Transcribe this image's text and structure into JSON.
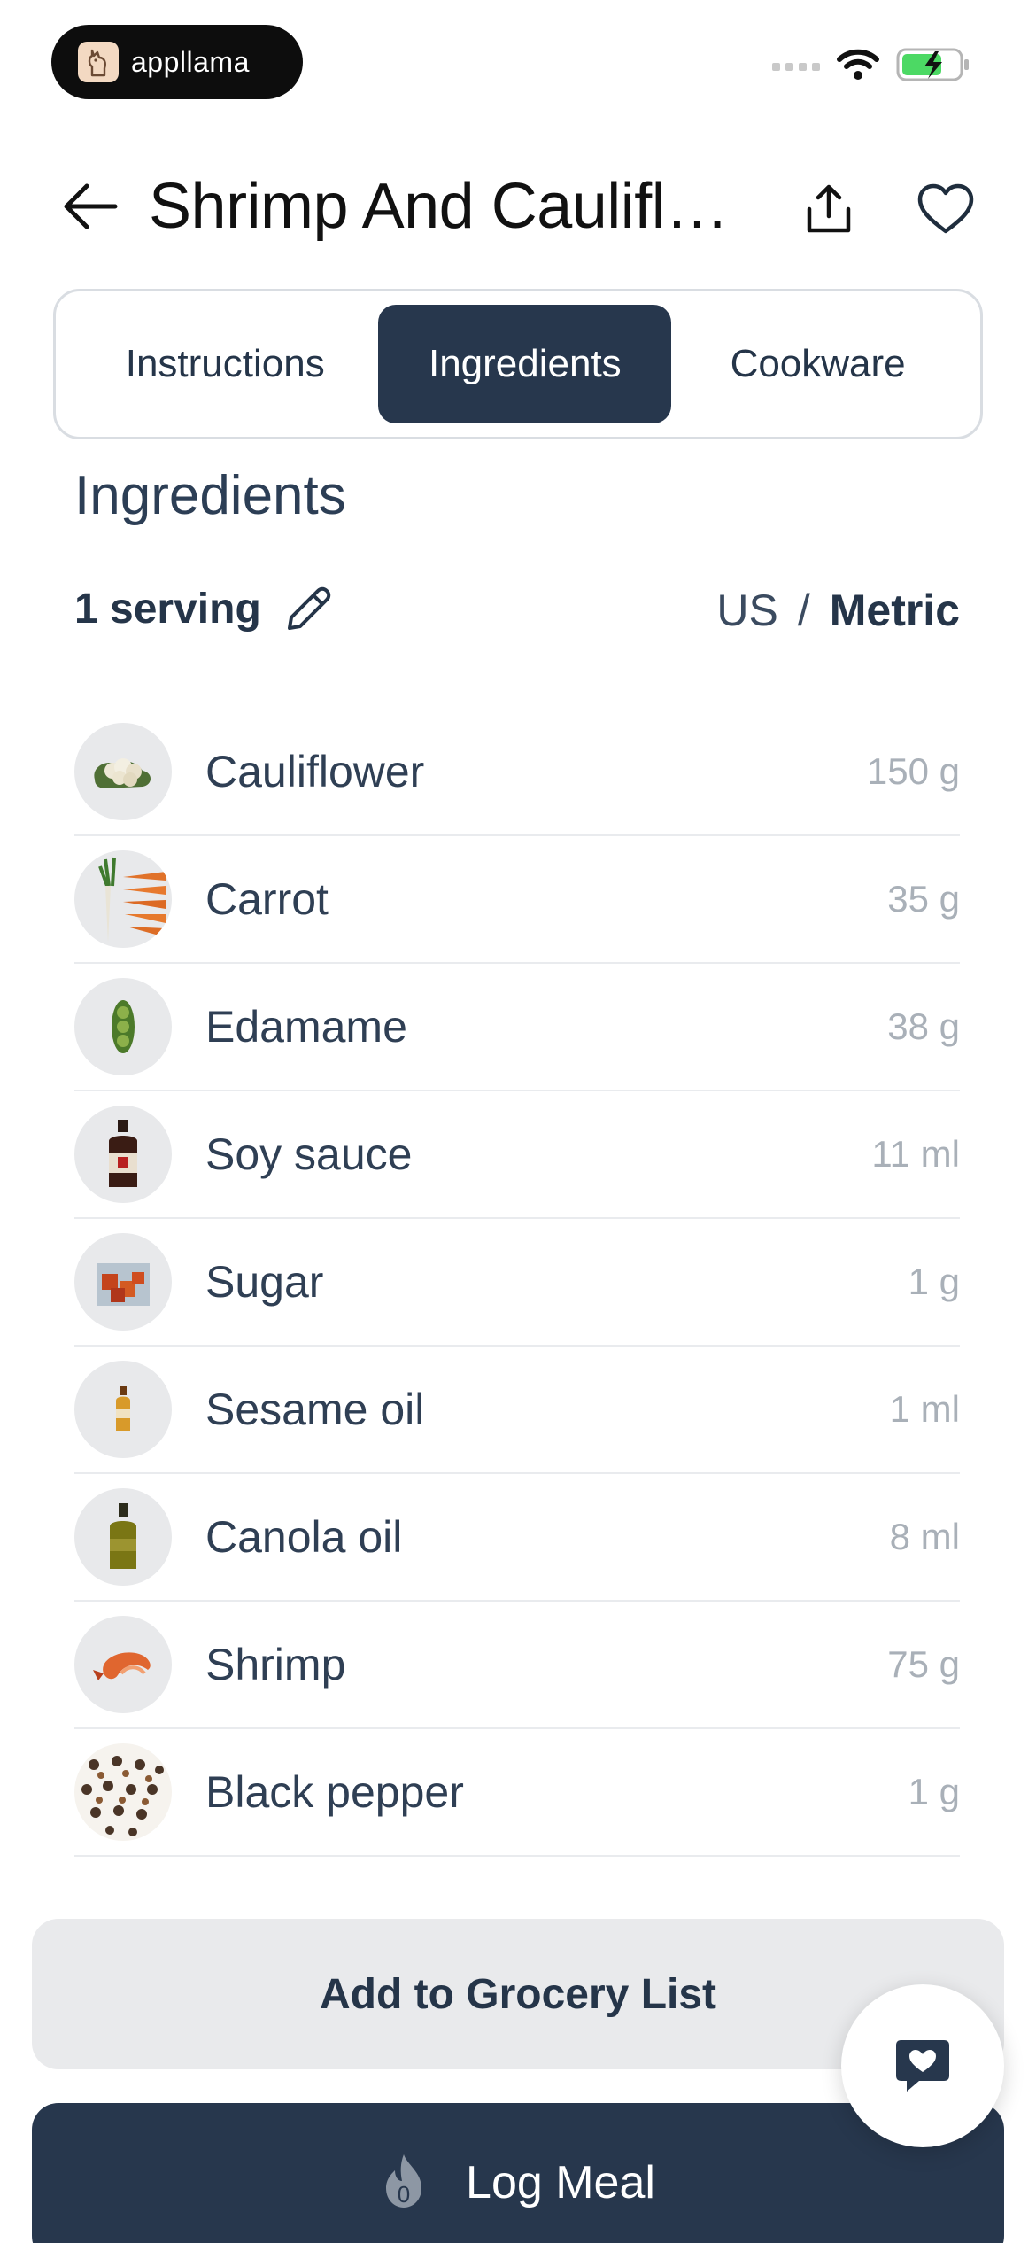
{
  "status_bar": {
    "brand": "appllama"
  },
  "header": {
    "title": "Shrimp And Cauliflo..."
  },
  "tabs": [
    {
      "label": "Instructions",
      "active": false
    },
    {
      "label": "Ingredients",
      "active": true
    },
    {
      "label": "Cookware",
      "active": false
    }
  ],
  "section": {
    "title": "Ingredients",
    "serving": "1 serving",
    "units": {
      "us": "US",
      "separator": "/",
      "metric": "Metric",
      "selected": "Metric"
    }
  },
  "ingredients": [
    {
      "name": "Cauliflower",
      "qty": "150 g",
      "icon": "cauliflower-icon"
    },
    {
      "name": "Carrot",
      "qty": "35 g",
      "icon": "carrot-icon"
    },
    {
      "name": "Edamame",
      "qty": "38 g",
      "icon": "edamame-icon"
    },
    {
      "name": "Soy sauce",
      "qty": "11 ml",
      "icon": "soy-sauce-icon"
    },
    {
      "name": "Sugar",
      "qty": "1 g",
      "icon": "sugar-icon"
    },
    {
      "name": "Sesame oil",
      "qty": "1 ml",
      "icon": "sesame-oil-icon"
    },
    {
      "name": "Canola oil",
      "qty": "8 ml",
      "icon": "canola-oil-icon"
    },
    {
      "name": "Shrimp",
      "qty": "75 g",
      "icon": "shrimp-icon"
    },
    {
      "name": "Black pepper",
      "qty": "1 g",
      "icon": "black-pepper-icon"
    }
  ],
  "actions": {
    "grocery": "Add to Grocery List",
    "log_meal": "Log Meal",
    "flame_count": "0"
  },
  "colors": {
    "primary": "#27374d",
    "muted": "#a9b0b8",
    "surface": "#e9eaec"
  }
}
